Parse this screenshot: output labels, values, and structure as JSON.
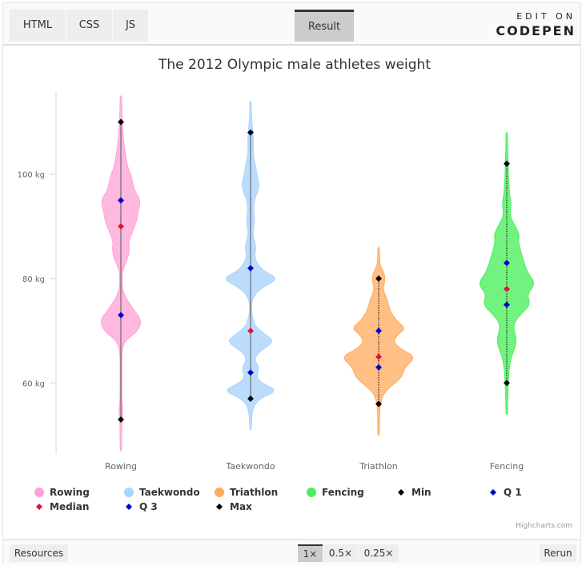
{
  "codepen": {
    "tabs": [
      "HTML",
      "CSS",
      "JS"
    ],
    "result_tab": "Result",
    "edit_on": "EDIT ON",
    "logo": "CODEPEN",
    "resources": "Resources",
    "zoom_options": [
      "1×",
      "0.5×",
      "0.25×"
    ],
    "zoom_selected": "1×",
    "rerun": "Rerun"
  },
  "credit": "Highcharts.com",
  "chart_data": {
    "type": "violin",
    "title": "The 2012 Olympic male athletes weight",
    "categories": [
      "Rowing",
      "Taekwondo",
      "Triathlon",
      "Fencing"
    ],
    "yaxis": {
      "ticks": [
        60,
        80,
        100
      ],
      "tick_labels": [
        "60 kg",
        "80 kg",
        "100 kg"
      ],
      "range": [
        46.4,
        115.7
      ],
      "unit": "kg"
    },
    "grid": false,
    "legend_placement": "bottom",
    "series": [
      {
        "name": "Rowing",
        "color": "#ff9fd5",
        "fill": "#ffb8de",
        "density": [
          [
            47,
            0.01
          ],
          [
            52,
            0.02
          ],
          [
            54,
            0.05
          ],
          [
            55,
            0.07
          ],
          [
            56.5,
            0.03
          ],
          [
            60,
            0.01
          ],
          [
            66,
            0.02
          ],
          [
            68,
            0.12
          ],
          [
            70,
            0.6
          ],
          [
            72,
            0.72
          ],
          [
            74,
            0.45
          ],
          [
            77,
            0.08
          ],
          [
            80,
            0.02
          ],
          [
            82,
            0.08
          ],
          [
            84,
            0.25
          ],
          [
            86,
            0.3
          ],
          [
            87,
            0.26
          ],
          [
            89,
            0.4
          ],
          [
            91,
            0.55
          ],
          [
            93,
            0.6
          ],
          [
            95,
            0.69
          ],
          [
            97,
            0.45
          ],
          [
            100,
            0.35
          ],
          [
            101,
            0.25
          ],
          [
            104,
            0.15
          ],
          [
            107,
            0.08
          ],
          [
            110,
            0.05
          ],
          [
            113,
            0.02
          ],
          [
            115,
            0.01
          ]
        ]
      },
      {
        "name": "Taekwondo",
        "color": "#a8d4ff",
        "fill": "#bcdcfd",
        "density": [
          [
            51,
            0.02
          ],
          [
            55,
            0.05
          ],
          [
            57,
            0.3
          ],
          [
            58.5,
            0.95
          ],
          [
            60,
            0.4
          ],
          [
            61,
            0.2
          ],
          [
            63,
            0.3
          ],
          [
            64.5,
            0.12
          ],
          [
            66,
            0.3
          ],
          [
            68,
            0.85
          ],
          [
            69.5,
            0.45
          ],
          [
            71,
            0.15
          ],
          [
            72,
            0.1
          ],
          [
            73.5,
            0.03
          ],
          [
            76,
            0.04
          ],
          [
            78,
            0.3
          ],
          [
            80,
            1.0
          ],
          [
            81.5,
            0.4
          ],
          [
            84,
            0.12
          ],
          [
            86,
            0.2
          ],
          [
            88,
            0.1
          ],
          [
            89,
            0.08
          ],
          [
            91,
            0.15
          ],
          [
            93,
            0.1
          ],
          [
            95,
            0.12
          ],
          [
            97.5,
            0.32
          ],
          [
            100,
            0.22
          ],
          [
            101.5,
            0.18
          ],
          [
            104,
            0.08
          ],
          [
            106,
            0.1
          ],
          [
            108,
            0.08
          ],
          [
            111,
            0.03
          ],
          [
            114,
            0.02
          ]
        ]
      },
      {
        "name": "Triathlon",
        "color": "#ffa95a",
        "fill": "#ffbf85",
        "density": [
          [
            50,
            0.02
          ],
          [
            54,
            0.03
          ],
          [
            56,
            0.06
          ],
          [
            57.8,
            0.15
          ],
          [
            59.3,
            0.4
          ],
          [
            61,
            0.8
          ],
          [
            63,
            0.9
          ],
          [
            65,
            1.3
          ],
          [
            66.5,
            0.75
          ],
          [
            68,
            0.5
          ],
          [
            69.5,
            0.7
          ],
          [
            70.5,
            0.93
          ],
          [
            72,
            0.6
          ],
          [
            74,
            0.38
          ],
          [
            76,
            0.3
          ],
          [
            78,
            0.14
          ],
          [
            79.5,
            0.22
          ],
          [
            81,
            0.2
          ],
          [
            82.5,
            0.05
          ],
          [
            84,
            0.03
          ],
          [
            86,
            0.02
          ]
        ]
      },
      {
        "name": "Fencing",
        "color": "#50ec5e",
        "fill": "#72f27e",
        "density": [
          [
            54,
            0.01
          ],
          [
            56,
            0.02
          ],
          [
            59,
            0.05
          ],
          [
            62,
            0.07
          ],
          [
            65,
            0.15
          ],
          [
            68,
            0.37
          ],
          [
            71,
            0.2
          ],
          [
            73,
            0.45
          ],
          [
            75,
            0.83
          ],
          [
            77,
            0.7
          ],
          [
            79,
            1.0
          ],
          [
            81,
            0.74
          ],
          [
            83,
            0.6
          ],
          [
            85,
            0.5
          ],
          [
            87,
            0.4
          ],
          [
            88.5,
            0.44
          ],
          [
            90,
            0.3
          ],
          [
            92,
            0.1
          ],
          [
            94.6,
            0.16
          ],
          [
            96,
            0.1
          ],
          [
            99,
            0.06
          ],
          [
            102,
            0.05
          ],
          [
            105,
            0.03
          ],
          [
            108,
            0.02
          ]
        ]
      }
    ],
    "stats": [
      {
        "name": "Min",
        "color": "#000000",
        "values": [
          53,
          57,
          56,
          60
        ]
      },
      {
        "name": "Q 1",
        "color": "#0000cc",
        "values": [
          73,
          62,
          63,
          75
        ]
      },
      {
        "name": "Median",
        "color": "#dc143c",
        "values": [
          90,
          70,
          65,
          78
        ]
      },
      {
        "name": "Q 3",
        "color": "#0000cc",
        "values": [
          95,
          82,
          70,
          83
        ]
      },
      {
        "name": "Max",
        "color": "#000000",
        "values": [
          110,
          108,
          80,
          102
        ]
      }
    ]
  }
}
